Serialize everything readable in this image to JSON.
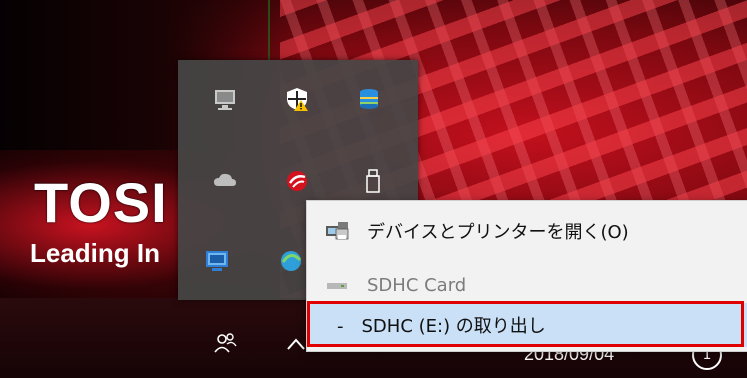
{
  "wallpaper": {
    "brand": "TOSI",
    "tagline": "Leading In"
  },
  "tray": {
    "icons": [
      "monitor-icon",
      "security-shield-warning-icon",
      "storage-icon",
      "onedrive-cloud-icon",
      "trend-micro-icon",
      "usb-drive-icon",
      "intel-graphics-icon",
      "edge-sync-icon"
    ]
  },
  "menu": {
    "open_devices_label": "デバイスとプリンターを開く(O)",
    "device_label": "SDHC Card",
    "eject_label": "-　SDHC (E:) の取り出し"
  },
  "taskbar": {
    "clock_date": "2018/09/04",
    "people_glyph": "ጸ",
    "chevron_glyph": "^"
  },
  "colors": {
    "highlight": "#e00000",
    "menu_bg": "#f2f2f2",
    "selection_bg": "#c9e0f7"
  }
}
